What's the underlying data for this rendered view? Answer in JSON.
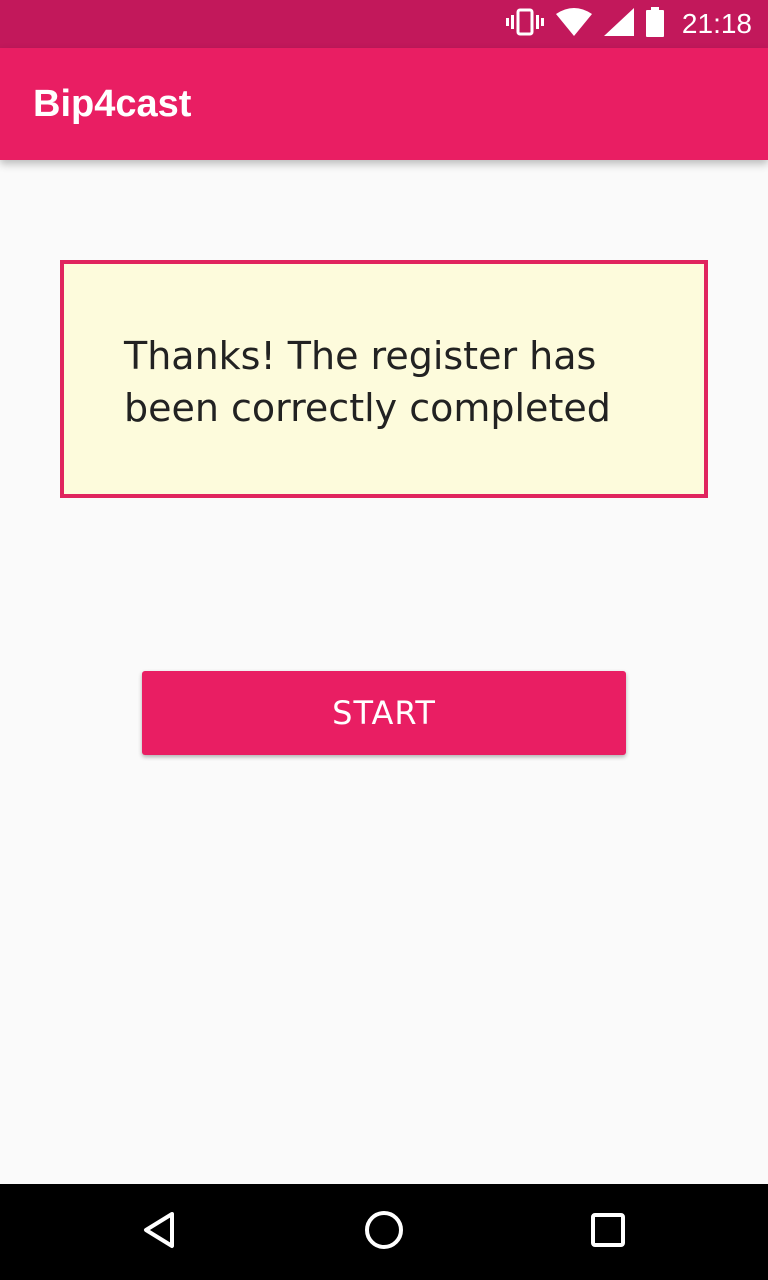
{
  "status_bar": {
    "time": "21:18",
    "icons": [
      "vibrate-icon",
      "wifi-icon",
      "signal-icon",
      "battery-icon"
    ]
  },
  "app_bar": {
    "title": "Bip4cast"
  },
  "message": {
    "text": "Thanks! The register has been correctly completed"
  },
  "start_button": {
    "label": "START"
  },
  "nav_bar": {
    "buttons": [
      "back-icon",
      "home-icon",
      "recents-icon"
    ]
  },
  "colors": {
    "status_bar": "#c2185b",
    "app_bar": "#e91e63",
    "accent": "#e91e63",
    "message_border": "#e0245e",
    "message_background": "#fdfbdc",
    "background": "#fafafa",
    "nav_bar": "#000000"
  }
}
